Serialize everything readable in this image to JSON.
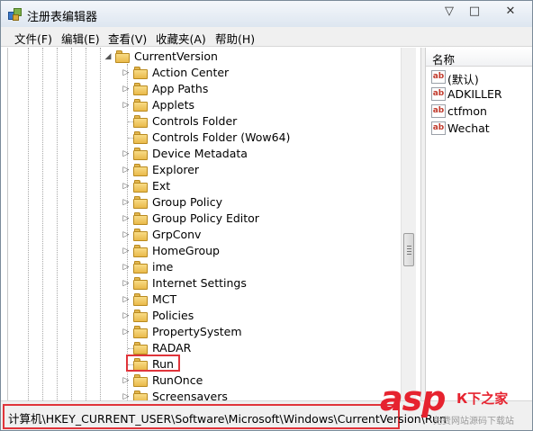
{
  "window": {
    "title": "注册表编辑器",
    "controls": {
      "minimize": "▽",
      "maximize": "□",
      "close": "✕"
    }
  },
  "menu": [
    "文件(F)",
    "编辑(E)",
    "查看(V)",
    "收藏夹(A)",
    "帮助(H)"
  ],
  "tree": {
    "parent": "CurrentVersion",
    "items": [
      "Action Center",
      "App Paths",
      "Applets",
      "Controls Folder",
      "Controls Folder (Wow64)",
      "Device Metadata",
      "Explorer",
      "Ext",
      "Group Policy",
      "Group Policy Editor",
      "GrpConv",
      "HomeGroup",
      "ime",
      "Internet Settings",
      "MCT",
      "Policies",
      "PropertySystem",
      "RADAR",
      "Run",
      "RunOnce",
      "Screensavers"
    ],
    "selected": "Run"
  },
  "values_pane": {
    "header": "名称",
    "icon_label": "ab",
    "items": [
      "(默认)",
      "ADKILLER",
      "ctfmon",
      "Wechat"
    ]
  },
  "status": {
    "path": "计算机\\HKEY_CURRENT_USER\\Software\\Microsoft\\Windows\\CurrentVersion\\Run"
  },
  "watermark": {
    "brand": "asp",
    "brand_cn": "К下之家",
    "subtitle": "免费网站源码下载站",
    "accent_color": "#e6232f"
  },
  "colors": {
    "highlight_border": "#e0343a",
    "folder": "#e9b94a"
  }
}
